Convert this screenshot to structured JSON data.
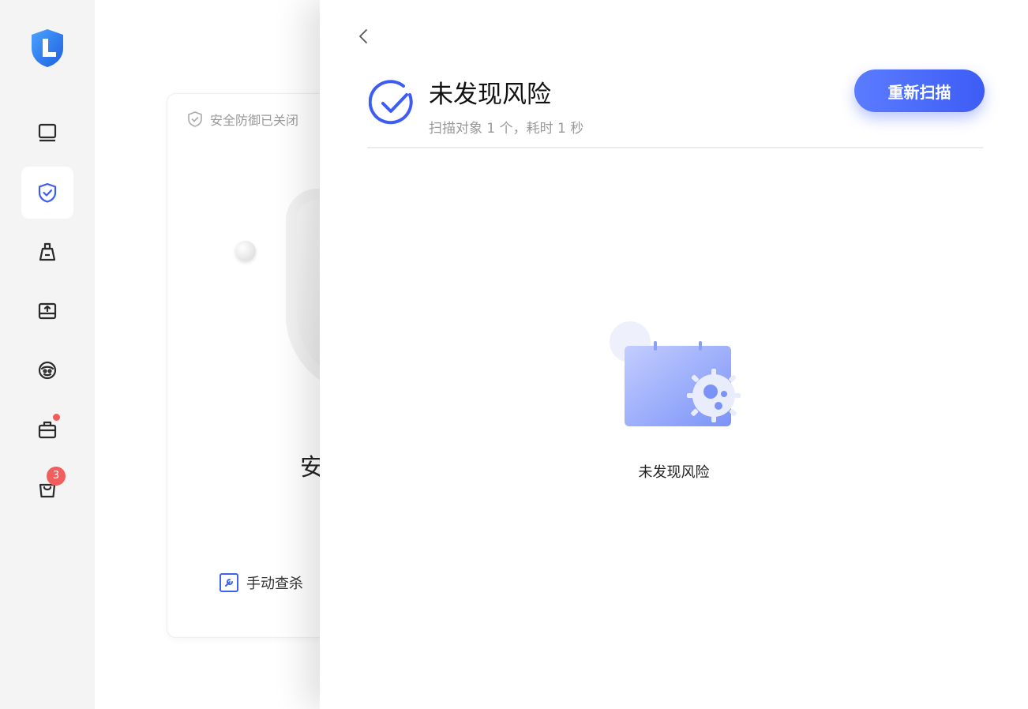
{
  "sidebar": {
    "items": [
      {
        "name": "computer",
        "icon": "monitor-icon"
      },
      {
        "name": "security",
        "icon": "shield-check-icon",
        "active": true
      },
      {
        "name": "cleanup",
        "icon": "broom-icon"
      },
      {
        "name": "storage",
        "icon": "drive-upload-icon"
      },
      {
        "name": "privacy",
        "icon": "eye-face-icon"
      },
      {
        "name": "toolbox",
        "icon": "briefcase-icon",
        "has_dot": true
      },
      {
        "name": "store",
        "icon": "shopping-bag-icon",
        "badge": "3"
      }
    ]
  },
  "card": {
    "status_text": "安全防御已关闭",
    "big_text": "安",
    "manual_label": "手动查杀"
  },
  "panel": {
    "title": "未发现风险",
    "subtitle": "扫描对象 1 个，耗时 1 秒",
    "rescan_label": "重新扫描",
    "empty_text": "未发现风险"
  },
  "colors": {
    "accent": "#3d5cf5",
    "badge": "#f25d5d"
  }
}
